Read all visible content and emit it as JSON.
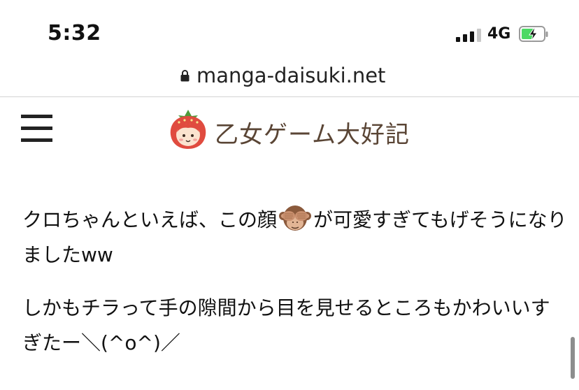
{
  "status_bar": {
    "time": "5:32",
    "network": "4G",
    "signal_bars_active": 3,
    "signal_bars_total": 4,
    "battery_charging": true,
    "battery_color": "#4cd964"
  },
  "browser": {
    "url": "manga-daisuki.net",
    "secure_icon": "lock-icon"
  },
  "site": {
    "menu_icon": "hamburger-menu-icon",
    "logo_icon": "strawberry-mascot-icon",
    "title": "乙女ゲーム大好記",
    "title_color": "#5a4535"
  },
  "article": {
    "para1_before": "クロちゃんといえば、この顔",
    "para1_emoji": "see-no-evil-monkey-icon",
    "para1_after": "が可愛すぎてもげそうになりましたww",
    "para2": "しかもチラって手の隙間から目を見せるところもかわいいすぎたー＼(^o^)／"
  }
}
